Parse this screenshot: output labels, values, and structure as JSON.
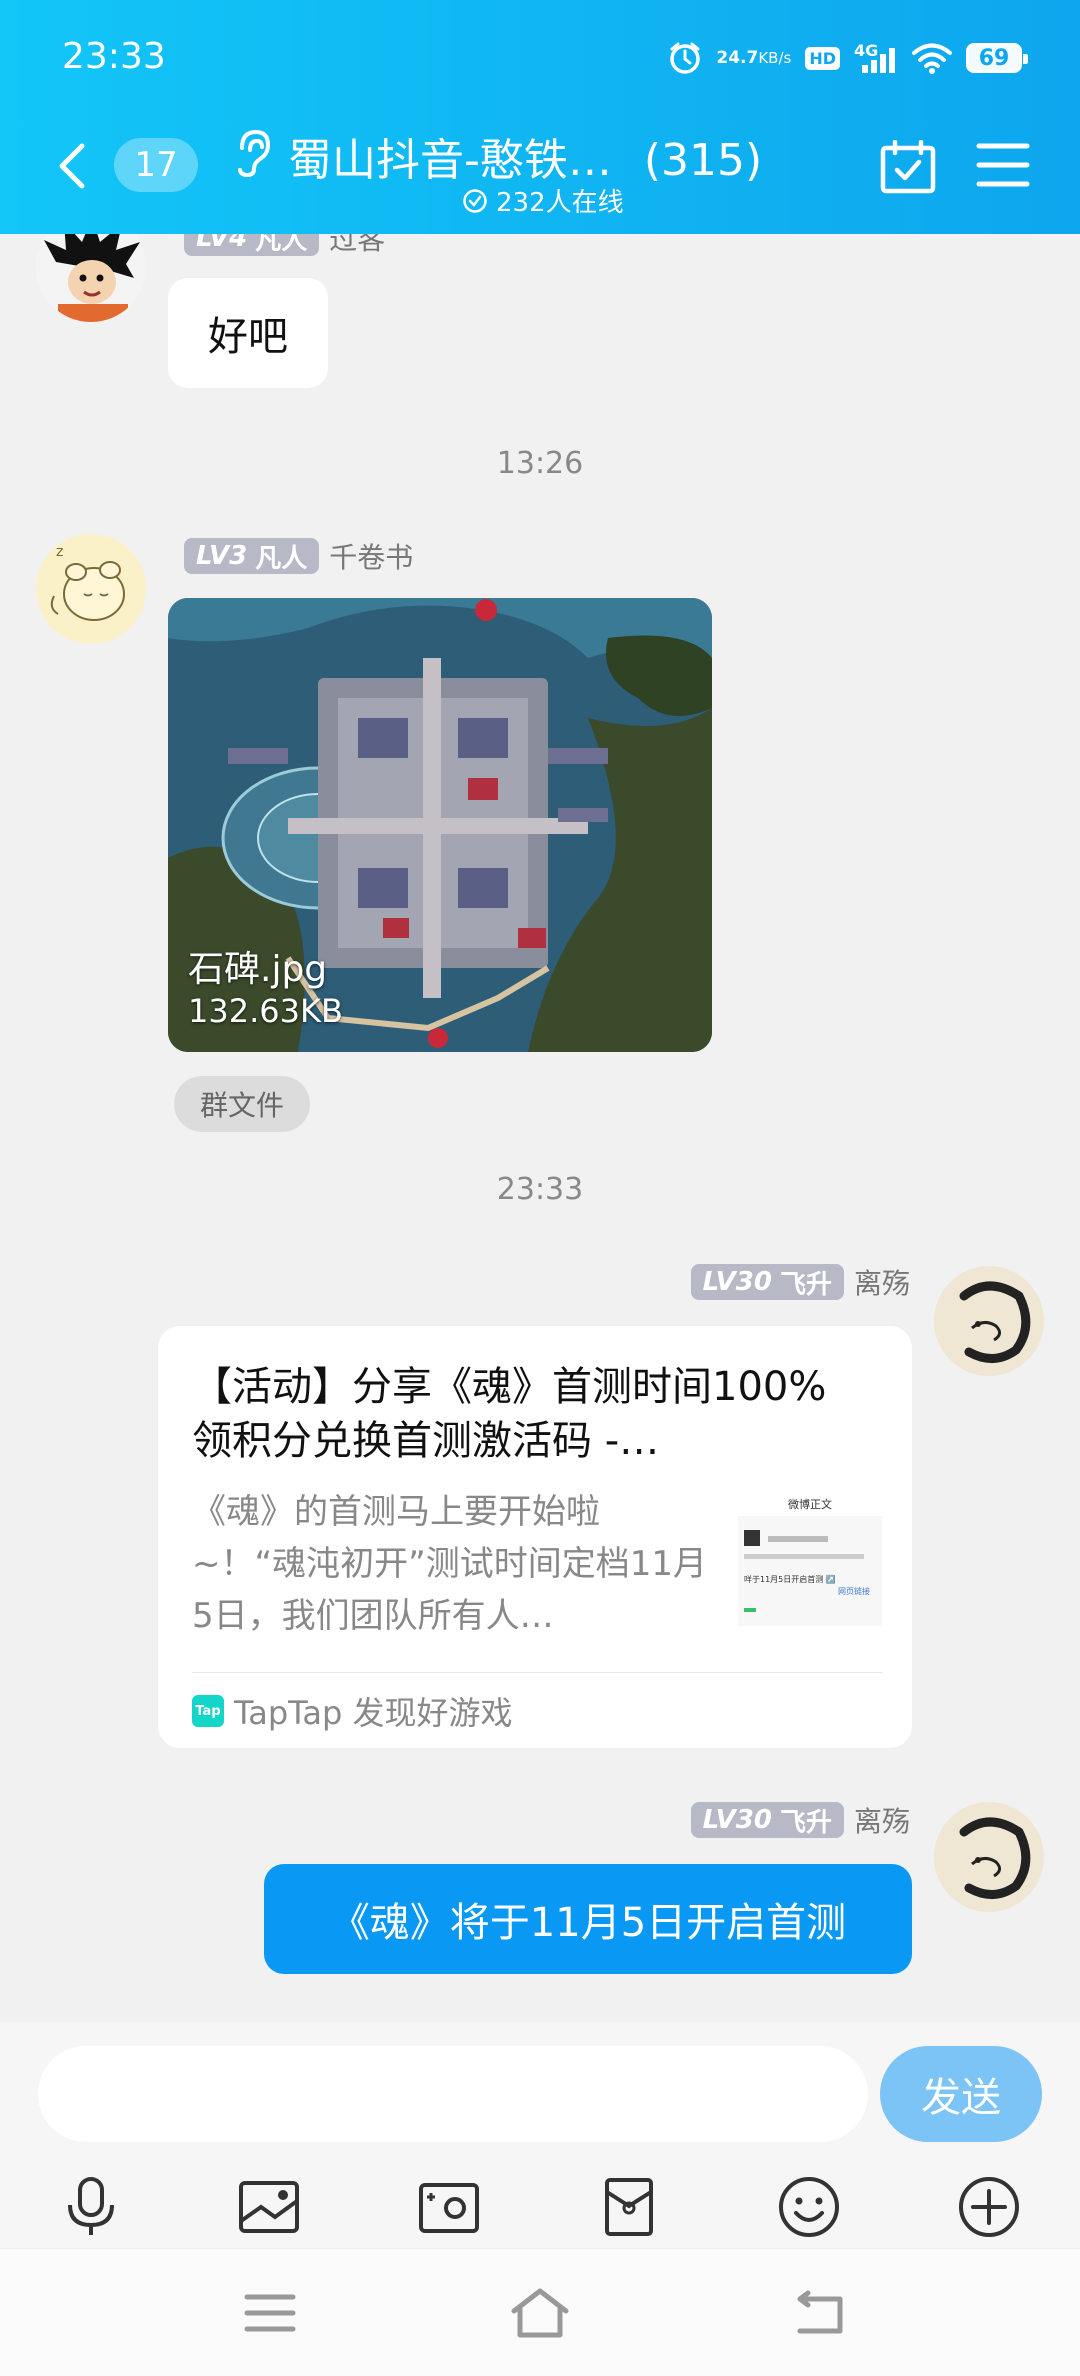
{
  "status_bar": {
    "time": "23:33",
    "net_speed_value": "24.7",
    "net_speed_unit": "KB/s",
    "hd_label": "HD",
    "network_label": "4G",
    "battery": "69"
  },
  "header": {
    "unread_count": "17",
    "group_title": "蜀山抖音-憨铁…",
    "member_count": "(315)",
    "online_text": "232人在线"
  },
  "messages": [
    {
      "level": "LV4",
      "rank": "凡人",
      "name": "过客",
      "text": "好吧"
    },
    {
      "time": "13:26"
    },
    {
      "level": "LV3",
      "rank": "凡人",
      "name": "千卷书",
      "image_name": "石碑.jpg",
      "image_size": "132.63KB",
      "tag": "群文件"
    },
    {
      "time": "23:33"
    },
    {
      "level": "LV30",
      "rank": "飞升",
      "name": "离殇",
      "share_title": "【活动】分享《魂》首测时间100%领积分兑换首测激活码 -…",
      "share_desc": "《魂》的首测马上要开始啦~！“魂沌初开”测试时间定档11月5日，我们团队所有人…",
      "share_source": "TapTap 发现好游戏",
      "thumb_title": "微博正文",
      "thumb_line": "咩于11月5日开启首测 ↗️",
      "thumb_link": "网页链接"
    },
    {
      "level": "LV30",
      "rank": "飞升",
      "name": "离殇",
      "text": "《魂》将于11月5日开启首测"
    }
  ],
  "input": {
    "placeholder": "",
    "send_label": "发送"
  },
  "tools": [
    "mic-icon",
    "image-icon",
    "camera-icon",
    "red-packet-icon",
    "emoji-icon",
    "plus-icon"
  ],
  "colors": {
    "header_start": "#12c6f8",
    "header_end": "#0ea6ee",
    "outgoing_bubble": "#0a98f5",
    "send_button": "#7cc4f5"
  }
}
